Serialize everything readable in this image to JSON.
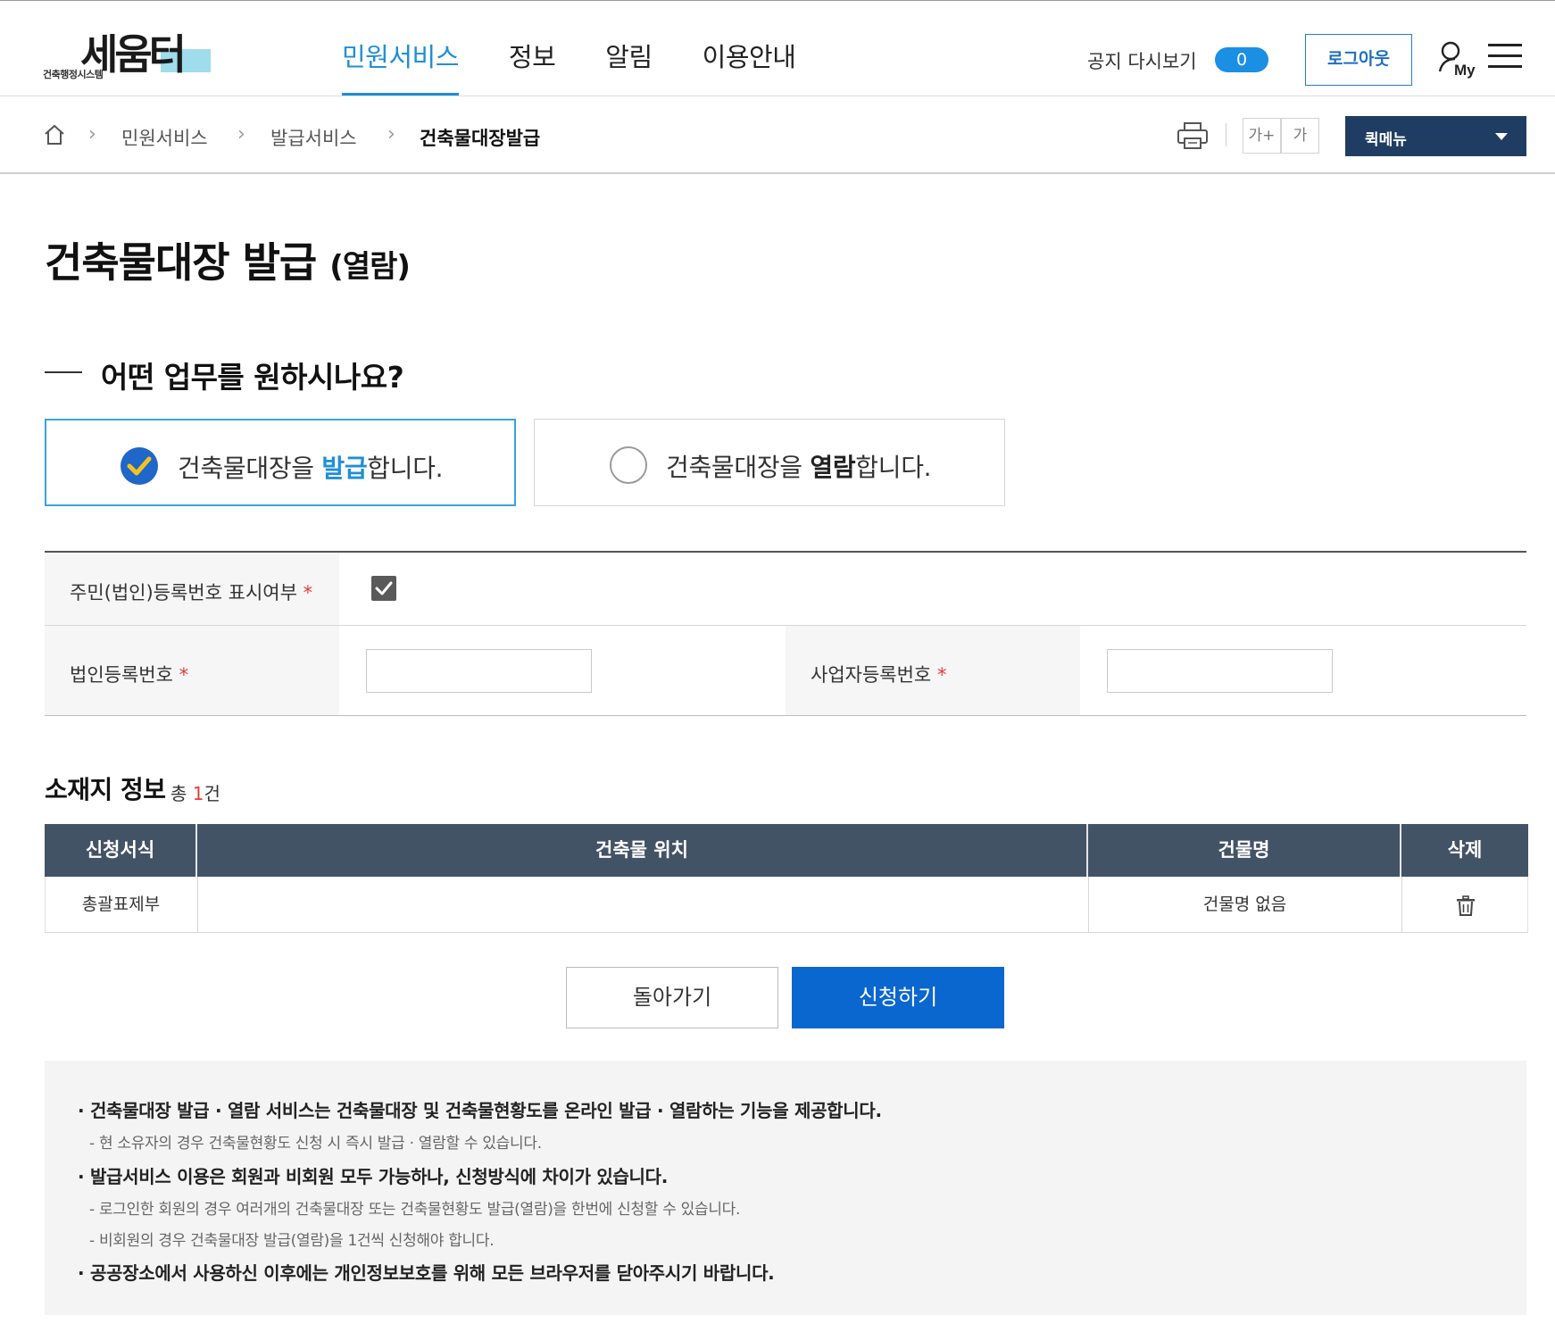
{
  "header": {
    "logo_sub": "건축행정시스템",
    "logo_main": "세움터",
    "nav": [
      "민원서비스",
      "정보",
      "알림",
      "이용안내"
    ],
    "active_nav": "민원서비스",
    "notice_reshow": "공지 다시보기",
    "notice_count": "0",
    "logout": "로그아웃",
    "my_label": "My"
  },
  "breadcrumb": {
    "items": [
      "민원서비스",
      "발급서비스",
      "건축물대장발급"
    ]
  },
  "tools": {
    "font_up": "가+",
    "font_default": "가",
    "quick_menu": "퀵메뉴"
  },
  "page": {
    "title": "건축물대장 발급",
    "title_sub": "(열람)",
    "question": "어떤 업무를 원하시나요?"
  },
  "options": [
    {
      "prefix": "건축물대장을 ",
      "keyword": "발급",
      "suffix": "합니다.",
      "selected": true
    },
    {
      "prefix": "건축물대장을 ",
      "keyword": "열람",
      "suffix": "합니다.",
      "selected": false
    }
  ],
  "form": {
    "id_display_label": "주민(법인)등록번호 표시여부",
    "id_display_checked": true,
    "corp_no_label": "법인등록번호",
    "corp_no_value": "",
    "biz_no_label": "사업자등록번호",
    "biz_no_value": "",
    "required_mark": "*"
  },
  "location": {
    "title": "소재지 정보",
    "count_prefix": "총 ",
    "count": "1",
    "count_suffix": "건",
    "columns": [
      "신청서식",
      "건축물 위치",
      "건물명",
      "삭제"
    ],
    "rows": [
      {
        "form_type": "총괄표제부",
        "address": "",
        "building_name": "건물명 없음"
      }
    ]
  },
  "buttons": {
    "back": "돌아가기",
    "apply": "신청하기"
  },
  "info": {
    "lines": [
      {
        "type": "main",
        "text": "· 건축물대장 발급 · 열람 서비스는 건축물대장 및 건축물현황도를 온라인 발급 · 열람하는 기능을 제공합니다."
      },
      {
        "type": "sub",
        "text": "- 현 소유자의 경우 건축물현황도 신청 시 즉시 발급 · 열람할 수 있습니다."
      },
      {
        "type": "main",
        "text": "· 발급서비스 이용은 회원과 비회원 모두 가능하나, 신청방식에 차이가 있습니다."
      },
      {
        "type": "sub",
        "text": "- 로그인한 회원의 경우 여러개의 건축물대장 또는 건축물현황도 발급(열람)을 한번에 신청할 수 있습니다."
      },
      {
        "type": "sub",
        "text": "- 비회원의 경우 건축물대장 발급(열람)을 1건씩 신청해야 합니다."
      },
      {
        "type": "main",
        "text": "· 공공장소에서 사용하신 이후에는 개인정보보호를 위해 모든 브라우저를 닫아주시기 바랍니다."
      }
    ]
  },
  "colors": {
    "accent_blue": "#1f8fd6",
    "table_header": "#435366",
    "apply_button": "#0a67cf",
    "quick_menu": "#1f3d63",
    "required": "#e23c3c"
  }
}
